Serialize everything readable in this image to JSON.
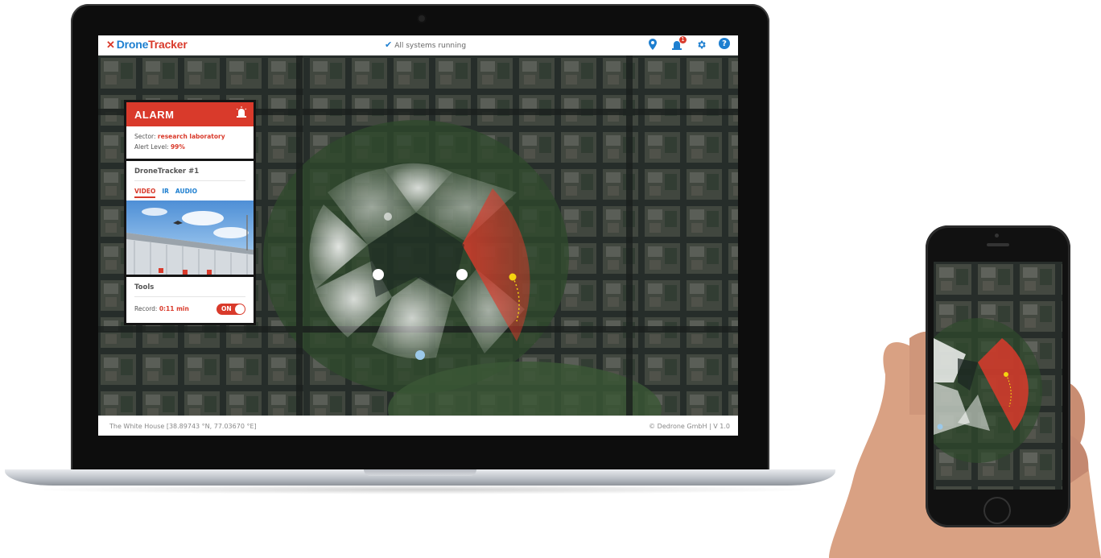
{
  "app": {
    "logo_drone": "Drone",
    "logo_tracker": "Tracker",
    "status_text": "All systems running",
    "alarm_badge": "1"
  },
  "alarm": {
    "title": "ALARM",
    "sector_label": "Sector:",
    "sector_value": "research laboratory",
    "level_label": "Alert Level:",
    "level_value": "99%"
  },
  "tracker": {
    "title": "DroneTracker #1",
    "tabs": [
      "VIDEO",
      "IR",
      "AUDIO"
    ],
    "active_tab": "VIDEO"
  },
  "tools": {
    "title": "Tools",
    "record_label": "Record:",
    "record_value": "0:11 min",
    "toggle_label": "ON"
  },
  "footer": {
    "location": "The White House [38.89743 °N, 77.03670 °E]",
    "copyright": "© Dedrone GmbH  |  V 1.0"
  },
  "colors": {
    "brand_red": "#d93a2b",
    "brand_blue": "#1e7fd0",
    "map_dark": "#2c3330",
    "detection_yellow": "#f5d40f"
  },
  "icons": [
    "map-pin-icon",
    "siren-alert-icon",
    "gear-icon",
    "help-icon",
    "check-icon"
  ]
}
